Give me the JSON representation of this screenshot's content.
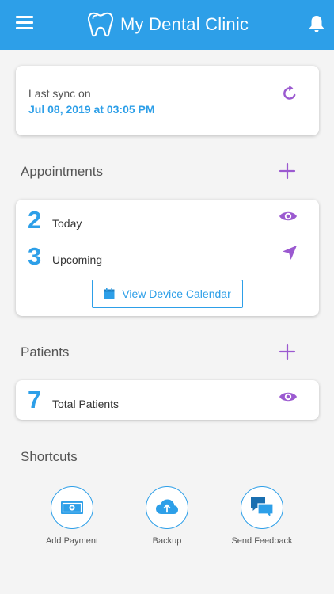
{
  "header": {
    "title": "My Dental Clinic",
    "menu_icon": "hamburger-icon",
    "logo_icon": "tooth-icon",
    "bell_icon": "bell-icon",
    "color": "#2d9fe8"
  },
  "sync": {
    "label": "Last sync on",
    "date": "Jul 08, 2019 at 03:05 PM",
    "refresh_icon": "refresh-icon"
  },
  "appointments": {
    "title": "Appointments",
    "add_icon": "plus-icon",
    "today_count": "2",
    "today_label": "Today",
    "upcoming_count": "3",
    "upcoming_label": "Upcoming",
    "view_icon": "eye-icon",
    "navigate_icon": "navigation-arrow-icon",
    "calendar_button": "View Device Calendar",
    "calendar_icon": "calendar-icon"
  },
  "patients": {
    "title": "Patients",
    "add_icon": "plus-icon",
    "total_count": "7",
    "total_label": "Total Patients",
    "view_icon": "eye-icon"
  },
  "shortcuts": {
    "title": "Shortcuts",
    "items": [
      {
        "label": "Add Payment",
        "icon": "cash-icon"
      },
      {
        "label": "Backup",
        "icon": "cloud-upload-icon"
      },
      {
        "label": "Send Feedback",
        "icon": "chat-bubbles-icon"
      }
    ]
  },
  "colors": {
    "primary": "#2d9fe8",
    "accent": "#9b59d0"
  }
}
